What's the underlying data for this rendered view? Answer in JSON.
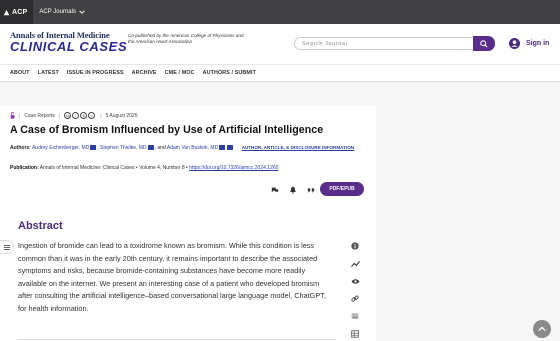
{
  "topbar": {
    "brand": "ACP",
    "journals": "ACP Journals"
  },
  "header": {
    "logo_line1": "Annals of Internal Medicine",
    "logo_line2": "CLINICAL CASES",
    "copublished": "Co-published by the American College of Physicians and the American Heart Association",
    "search_placeholder": "Search Journal",
    "signin": "Sign in"
  },
  "nav": {
    "items": [
      "ABOUT",
      "LATEST",
      "ISSUE IN PROGRESS",
      "ARCHIVE",
      "CME / MOC",
      "AUTHORS / SUBMIT"
    ]
  },
  "article": {
    "type": "Case Reports",
    "date": "5 August 2025",
    "title": "A Case of Bromism Influenced by Use of Artificial Intelligence",
    "authors_label": "Authors:",
    "author1": "Audrey Eichenberger, MD",
    "author2": "Stephen Thielke, MD",
    "and": ", and",
    "author3": "Adam Van Buskirk, MD",
    "affiliations": "AUTHOR, ARTICLE, & DISCLOSURE INFORMATION",
    "publication_label": "Publication:",
    "journal": "Annals of Internal Medicine: Clinical Cases",
    "volume": "Volume 4, Number 8",
    "doi": "https://doi.org/10.7326/aimcc.2024.1260",
    "pdf_label": "PDF/EPUB"
  },
  "abstract": {
    "heading": "Abstract",
    "text": "Ingestion of bromide can lead to a toxidrome known as bromism. While this condition is less common than it was in the early 20th century, it remains important to describe the associated symptoms and risks, because bromide-containing substances have become more readily available on the internet. We present an interesting case of a patient who developed bromism after consulting the artificial intelligence–based conversational large language model, ChatGPT, for health information."
  },
  "colors": {
    "brand_purple": "#5a2d8c",
    "topbar": "#414042",
    "link": "#2b3fa0"
  }
}
